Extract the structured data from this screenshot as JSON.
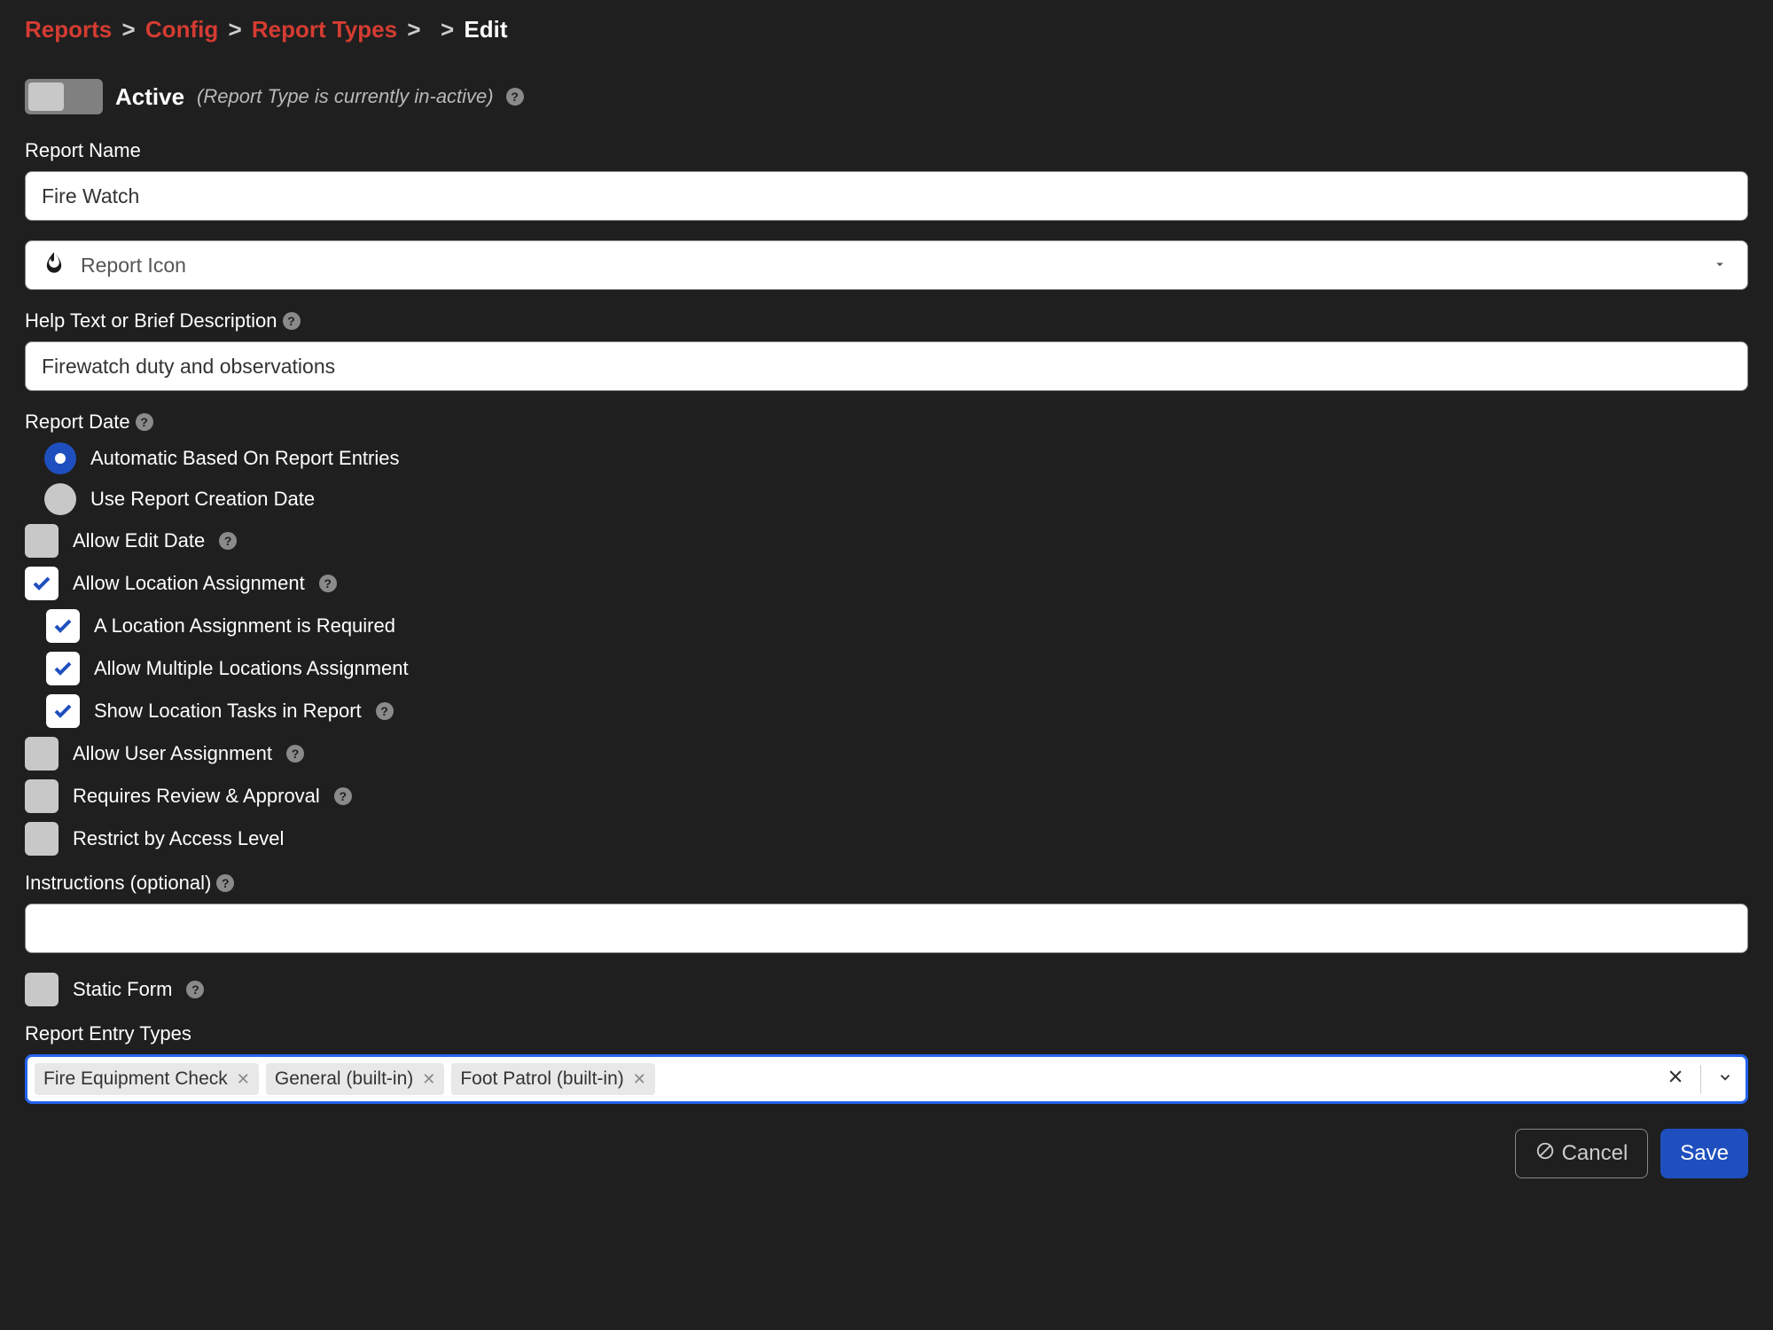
{
  "breadcrumb": {
    "reports": "Reports",
    "config": "Config",
    "report_types": "Report Types",
    "edit": "Edit"
  },
  "active": {
    "label": "Active",
    "sub": "(Report Type is currently in-active)"
  },
  "report_name": {
    "label": "Report Name",
    "value": "Fire Watch"
  },
  "report_icon": {
    "placeholder": "Report Icon"
  },
  "help_text": {
    "label": "Help Text or Brief Description",
    "value": "Firewatch duty and observations"
  },
  "report_date": {
    "label": "Report Date",
    "option_auto": "Automatic Based On Report Entries",
    "option_creation": "Use Report Creation Date"
  },
  "checks": {
    "allow_edit_date": "Allow Edit Date",
    "allow_location": "Allow Location Assignment",
    "location_required": "A Location Assignment is Required",
    "allow_multi_location": "Allow Multiple Locations Assignment",
    "show_location_tasks": "Show Location Tasks in Report",
    "allow_user": "Allow User Assignment",
    "requires_review": "Requires Review & Approval",
    "restrict_access": "Restrict by Access Level",
    "static_form": "Static Form"
  },
  "instructions": {
    "label": "Instructions (optional)",
    "value": ""
  },
  "entry_types": {
    "label": "Report Entry Types",
    "tags": [
      "Fire Equipment Check",
      "General (built-in)",
      "Foot Patrol (built-in)"
    ]
  },
  "buttons": {
    "cancel": "Cancel",
    "save": "Save"
  }
}
